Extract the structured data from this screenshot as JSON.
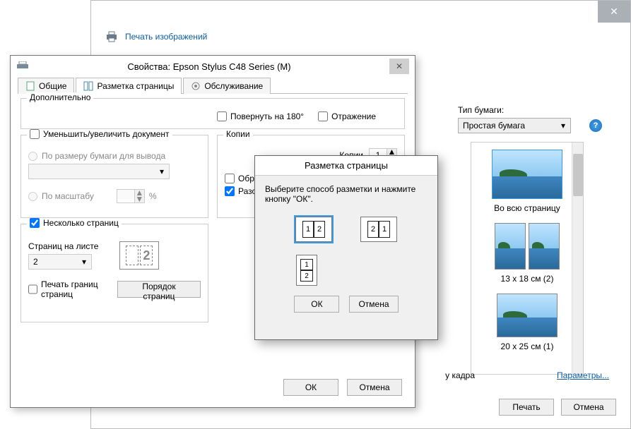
{
  "outer": {
    "title": "Печать изображений",
    "paper_type_label": "Тип бумаги:",
    "paper_type_value": "Простая бумага",
    "framing_text": "у кадра",
    "params_link": "Параметры...",
    "print_btn": "Печать",
    "cancel_btn": "Отмена",
    "layouts": [
      {
        "label": "Во всю страницу",
        "selected": true,
        "dual": false
      },
      {
        "label": "13 x 18 см (2)",
        "selected": false,
        "dual": true
      },
      {
        "label": "20 x 25 см (1)",
        "selected": false,
        "dual": false
      }
    ]
  },
  "props": {
    "title": "Свойства: Epson Stylus C48 Series (M)",
    "tabs": {
      "general": "Общие",
      "layout": "Разметка страницы",
      "maintenance": "Обслуживание"
    },
    "group_more": "Дополнительно",
    "rotate180": "Повернуть на 180°",
    "mirror": "Отражение",
    "reduce": "Уменьшить/увеличить документ",
    "fit_to_output": "По размеру бумаги для вывода",
    "by_scale": "По масштабу",
    "percent": "%",
    "copies_group": "Копии",
    "copies_label": "Копии",
    "copies_value": "1",
    "reverse": "Обратны",
    "collate": "Разобрат",
    "multipage": "Несколько страниц",
    "pages_per_sheet": "Страниц на листе",
    "pages_value": "2",
    "print_borders": "Печать границ страниц",
    "page_order_btn": "Порядок страниц",
    "ok": "ОК",
    "cancel": "Отмена"
  },
  "modal": {
    "title": "Разметка страницы",
    "hint": "Выберите способ разметки и нажмите кнопку \"ОК\".",
    "opt12": [
      "1",
      "2"
    ],
    "opt21": [
      "2",
      "1"
    ],
    "optv": [
      "1",
      "2"
    ],
    "ok": "ОК",
    "cancel": "Отмена"
  }
}
